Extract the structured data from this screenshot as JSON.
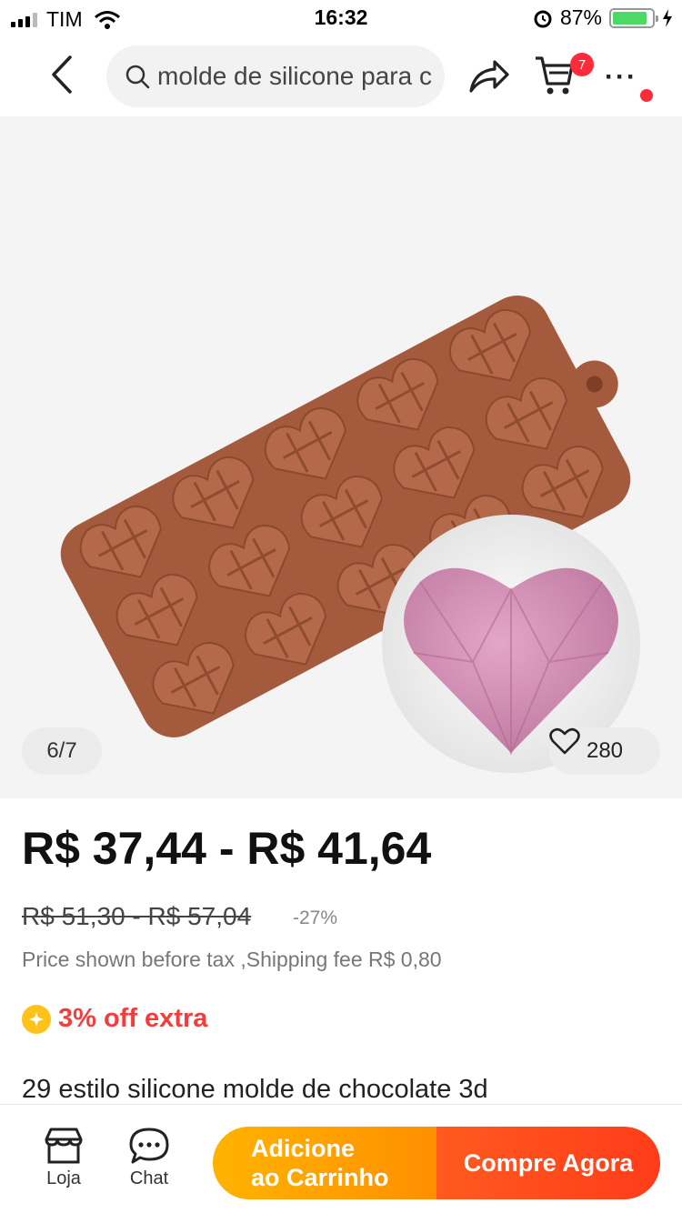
{
  "status_bar": {
    "carrier": "TIM",
    "time": "16:32",
    "battery": "87%",
    "battery_level": 0.87
  },
  "nav": {
    "search_query": "molde de silicone para c",
    "cart_count": "7"
  },
  "gallery": {
    "page_indicator": "6/7",
    "favorites": "280",
    "mold_color": "#a45a3c",
    "cavity_color": "#b4694a",
    "cake_color": "#d795b9"
  },
  "pricing": {
    "price_range": "R$ 37,44 - R$ 41,64",
    "original_range": "R$ 51,30 - R$ 57,04",
    "discount": "-27%",
    "note": "Price shown before tax ,Shipping fee R$ 0,80",
    "promo": "3% off extra"
  },
  "product": {
    "title": "29 estilo silicone molde de chocolate 3d"
  },
  "bottom_bar": {
    "store_label": "Loja",
    "chat_label": "Chat",
    "add_to_cart_line1": "Adicione",
    "add_to_cart_line2": "ao Carrinho",
    "buy_now": "Compre Agora"
  },
  "colors": {
    "accent_red": "#f23d3d",
    "badge_red": "#ff2a3a",
    "cart_orange": "#ffa000",
    "buy_orange": "#ff4a1c"
  },
  "icons": [
    "back-icon",
    "search-icon",
    "share-icon",
    "cart-icon",
    "more-icon",
    "heart-icon",
    "coin-icon",
    "store-icon",
    "chat-icon"
  ]
}
